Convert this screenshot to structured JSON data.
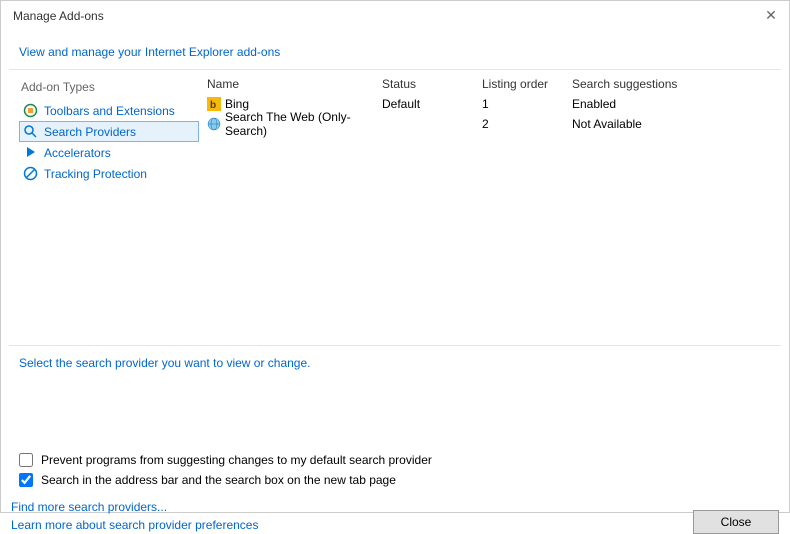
{
  "window": {
    "title": "Manage Add-ons",
    "subtitle": "View and manage your Internet Explorer add-ons"
  },
  "sidebar": {
    "title": "Add-on Types",
    "items": [
      {
        "label": "Toolbars and Extensions",
        "icon": "toolbars"
      },
      {
        "label": "Search Providers",
        "icon": "search"
      },
      {
        "label": "Accelerators",
        "icon": "accel"
      },
      {
        "label": "Tracking Protection",
        "icon": "tracking"
      }
    ],
    "selected_index": 1
  },
  "list": {
    "headers": {
      "name": "Name",
      "status": "Status",
      "order": "Listing order",
      "suggestions": "Search suggestions"
    },
    "rows": [
      {
        "name": "Bing",
        "status": "Default",
        "order": "1",
        "suggestions": "Enabled",
        "icon": "bing"
      },
      {
        "name": "Search The Web (Only-Search)",
        "status": "",
        "order": "2",
        "suggestions": "Not Available",
        "icon": "globe"
      }
    ]
  },
  "instruction": "Select the search provider you want to view or change.",
  "checkbox1": {
    "label": "Prevent programs from suggesting changes to my default search provider",
    "checked": false
  },
  "checkbox2": {
    "label": "Search in the address bar and the search box on the new tab page",
    "checked": true
  },
  "footer": {
    "link1": "Find more search providers...",
    "link2": "Learn more about search provider preferences",
    "close": "Close"
  }
}
